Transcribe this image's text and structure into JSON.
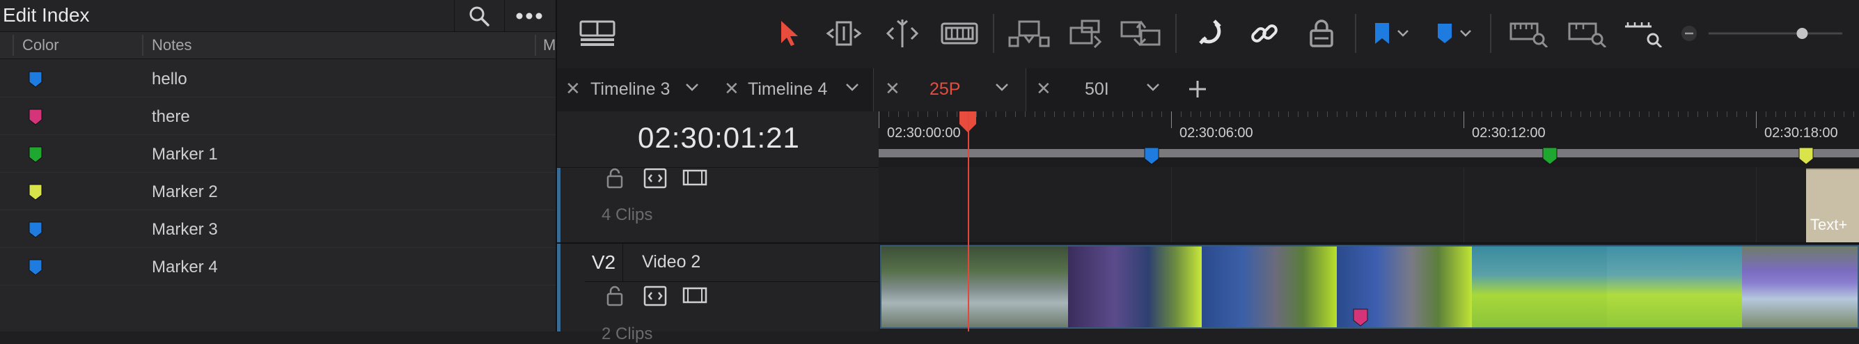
{
  "index": {
    "title": "Edit Index",
    "columns": {
      "color": "Color",
      "notes": "Notes",
      "more": "M"
    },
    "rows": [
      {
        "note": "hello",
        "color": "#1e7be0"
      },
      {
        "note": "there",
        "color": "#d6347a"
      },
      {
        "note": "Marker 1",
        "color": "#1fa830"
      },
      {
        "note": "Marker 2",
        "color": "#d9e34a"
      },
      {
        "note": "Marker 3",
        "color": "#1e7be0"
      },
      {
        "note": "Marker 4",
        "color": "#1e7be0"
      }
    ]
  },
  "toolbar": {
    "icons": [
      "timeline-view-icon",
      "selection-arrow-icon",
      "trim-edit-icon",
      "dynamic-trim-icon",
      "blade-icon",
      "insert-clip-icon",
      "overwrite-clip-icon",
      "replace-clip-icon",
      "snapping-icon",
      "linked-selection-icon",
      "position-lock-icon",
      "flag-icon",
      "marker-icon",
      "zoom-full-icon",
      "zoom-detail-icon",
      "zoom-custom-icon"
    ],
    "accent": "#e74c3c",
    "flag_color": "#1e7be0",
    "marker_color": "#1e7be0",
    "zoom_level": 0.7
  },
  "tabs": [
    {
      "label": "Timeline 3",
      "active": false
    },
    {
      "label": "Timeline 4",
      "active": false
    },
    {
      "label": "25P",
      "active": true
    },
    {
      "label": "50I",
      "active": false
    }
  ],
  "timeline": {
    "timecode": "02:30:01:21",
    "ruler_labels": [
      "02:30:00:00",
      "02:30:06:00",
      "02:30:12:00",
      "02:30:18:00"
    ],
    "ruler_markers": [
      {
        "color": "#1e7be0"
      },
      {
        "color": "#1fa830"
      },
      {
        "color": "#d9e34a"
      }
    ],
    "tracks": {
      "v3": {
        "clip_count": "4 Clips"
      },
      "v2": {
        "id": "V2",
        "name": "Video 2",
        "clip_count": "2 Clips"
      }
    },
    "text_clip": {
      "label": "Text+"
    }
  }
}
